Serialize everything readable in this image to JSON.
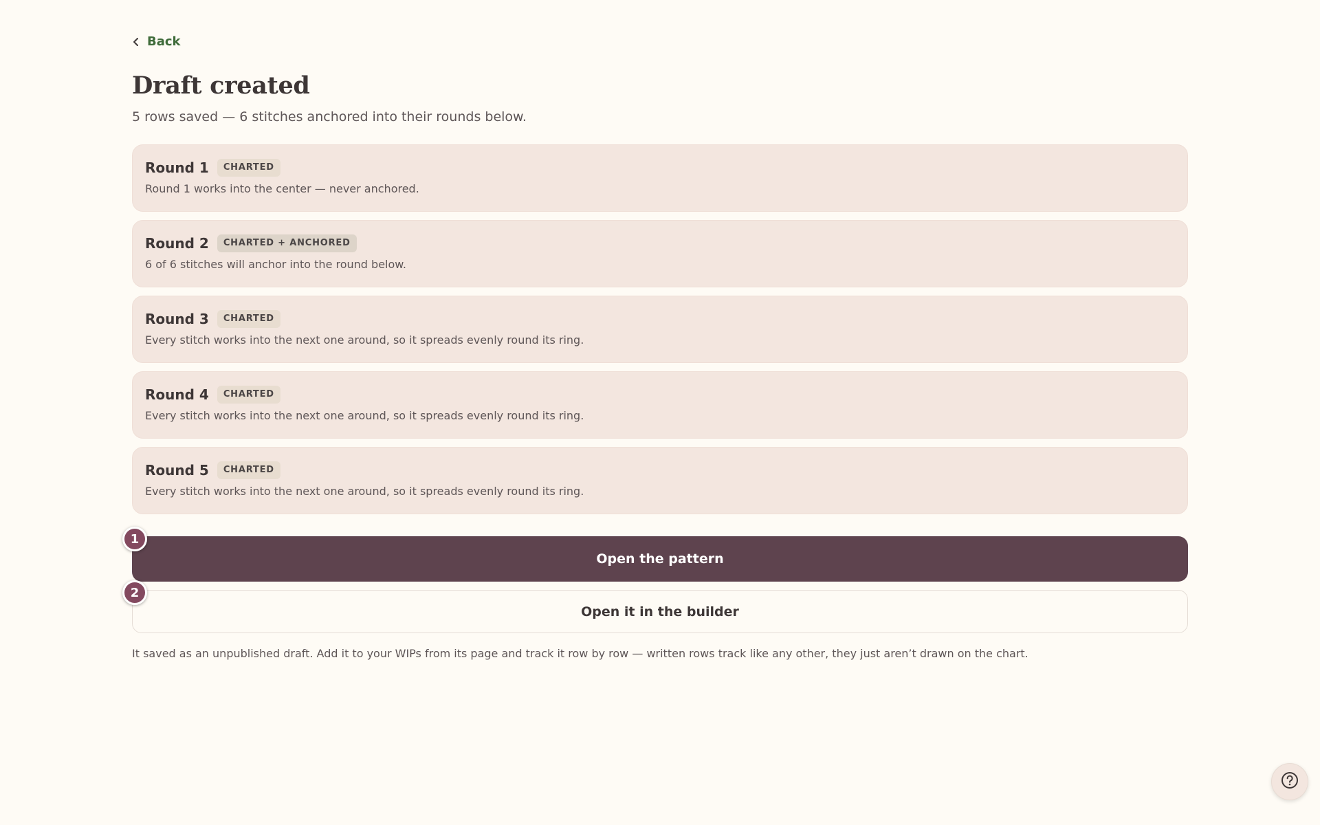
{
  "nav": {
    "back_label": "Back",
    "back_icon": "chevron-left-icon"
  },
  "header": {
    "title": "Draft created",
    "subtitle": "5 rows saved — 6 stitches anchored into their rounds below."
  },
  "rounds": [
    {
      "name": "Round 1",
      "badge": "CHARTED",
      "description": "Round 1 works into the center — never anchored."
    },
    {
      "name": "Round 2",
      "badge": "CHARTED + ANCHORED",
      "description": "6 of 6 stitches will anchor into the round below."
    },
    {
      "name": "Round 3",
      "badge": "CHARTED",
      "description": "Every stitch works into the next one around, so it spreads evenly round its ring."
    },
    {
      "name": "Round 4",
      "badge": "CHARTED",
      "description": "Every stitch works into the next one around, so it spreads evenly round its ring."
    },
    {
      "name": "Round 5",
      "badge": "CHARTED",
      "description": "Every stitch works into the next one around, so it spreads evenly round its ring."
    }
  ],
  "actions": {
    "primary_label": "Open the pattern",
    "secondary_label": "Open it in the builder",
    "step_markers": [
      "1",
      "2"
    ]
  },
  "footnote": "It saved as an unpublished draft. Add it to your WIPs from its page and track it row by row — written rows track like any other, they just aren’t drawn on the chart.",
  "help": {
    "icon": "help-circle-icon"
  },
  "colors": {
    "background": "#fefbf5",
    "card": "#f3e6df",
    "primary_button": "#5e434e",
    "link": "#3f6b3a",
    "step_marker": "#83495f"
  }
}
